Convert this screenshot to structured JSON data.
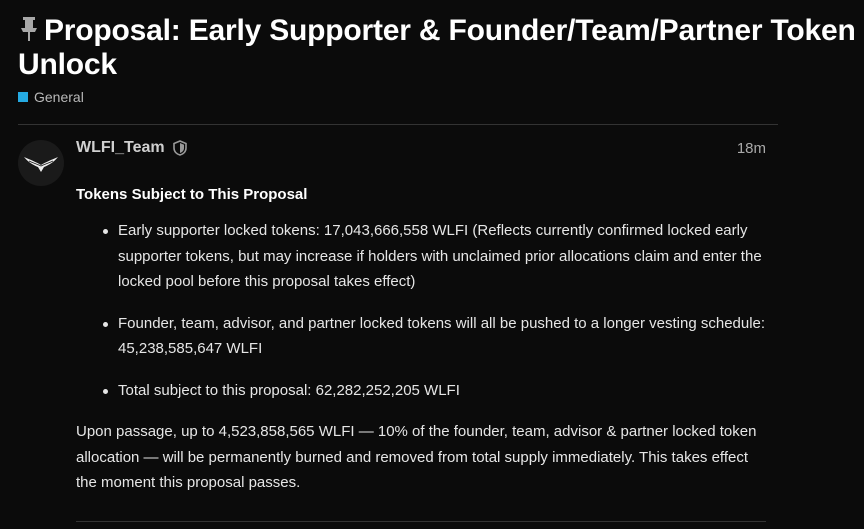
{
  "topic": {
    "title": "Proposal: Early Supporter & Founder/Team/Partner Token Unlock",
    "pin_icon": "pin-icon",
    "category": {
      "name": "General",
      "color": "#25aae1"
    }
  },
  "post": {
    "author": {
      "username": "WLFI_Team",
      "avatar_icon": "eagle-logo-icon",
      "badge_icon": "shield-icon"
    },
    "time_ago": "18m",
    "heading": "Tokens Subject to This Proposal",
    "bullets": [
      "Early supporter locked tokens: 17,043,666,558 WLFI (Reflects currently confirmed locked early supporter tokens, but may increase if holders with unclaimed prior allocations claim and enter the locked pool before this proposal takes effect)",
      "Founder, team, advisor, and partner locked tokens will all be pushed to a longer vesting schedule: 45,238,585,647 WLFI",
      "Total subject to this proposal: 62,282,252,205 WLFI"
    ],
    "paragraph": "Upon passage, up to 4,523,858,565 WLFI — 10% of the founder, team, advisor & partner locked token allocation — will be permanently burned and removed from total supply immediately. This takes effect the moment this proposal passes."
  }
}
